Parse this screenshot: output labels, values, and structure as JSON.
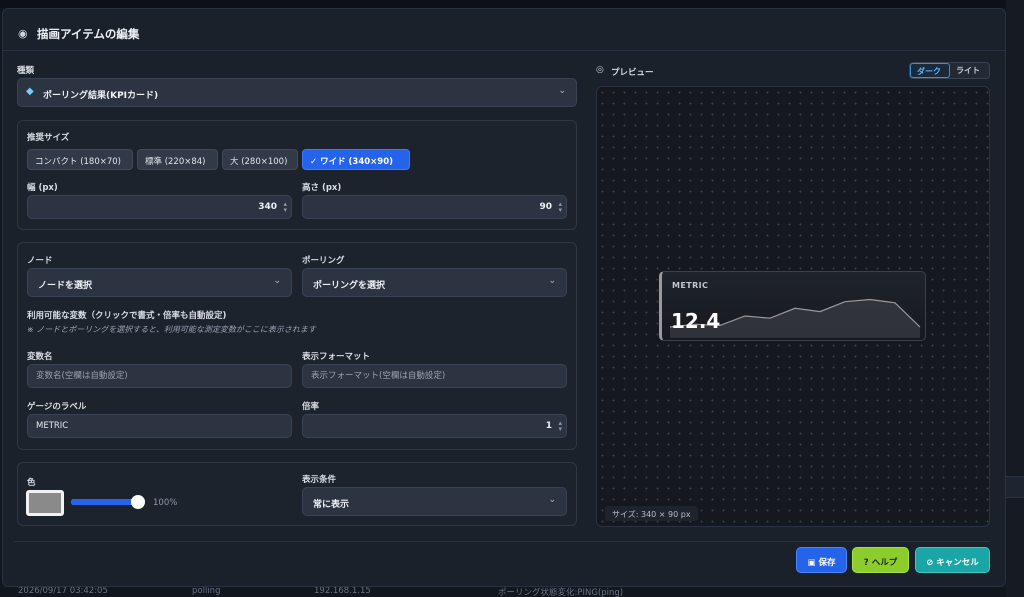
{
  "background": {
    "row": {
      "timestamp": "2026/09/17 03:42:05",
      "type": "polling",
      "ip": "192.168.1.15",
      "message": "ポーリング状態変化:PING(ping)"
    }
  },
  "modal": {
    "title": "描画アイテムの編集",
    "type_label": "種類",
    "type_value": "ポーリング結果(KPIカード)",
    "size": {
      "label": "推奨サイズ",
      "options": [
        "コンパクト (180×70)",
        "標準 (220×84)",
        "大 (280×100)",
        "✓ ワイド (340×90)"
      ],
      "width_label": "幅 (px)",
      "width_value": "340",
      "height_label": "高さ (px)",
      "height_value": "90"
    },
    "node": {
      "label": "ノード",
      "value": "ノードを選択"
    },
    "polling": {
      "label": "ポーリング",
      "value": "ポーリングを選択"
    },
    "vars": {
      "label": "利用可能な変数（クリックで書式・倍率も自動設定)",
      "hint": "※ ノードとポーリングを選択すると、利用可能な測定変数がここに表示されます"
    },
    "var_name": {
      "label": "変数名",
      "placeholder": "変数名(空欄は自動設定)"
    },
    "format": {
      "label": "表示フォーマット",
      "placeholder": "表示フォーマット(空欄は自動設定)"
    },
    "gauge_label": {
      "label": "ゲージのラベル",
      "value": "METRIC"
    },
    "scale": {
      "label": "倍率",
      "value": "1"
    },
    "color": {
      "label": "色",
      "swatch": "#8a8a8a",
      "opacity": "100%",
      "opacity_value": 1.0
    },
    "condition": {
      "label": "表示条件",
      "value": "常に表示"
    },
    "preview": {
      "label": "プレビュー",
      "theme_dark": "ダーク",
      "theme_light": "ライト",
      "kpi_name": "METRIC",
      "kpi_value": "12.4",
      "sparkline": [
        2,
        2.5,
        2.3,
        4,
        3.6,
        5.4,
        4.8,
        6.6,
        7,
        6.4,
        2
      ],
      "size_info": "サイズ: 340 × 90 px"
    },
    "buttons": {
      "save": "保存",
      "help": "ヘルプ",
      "cancel": "キャンセル"
    }
  }
}
